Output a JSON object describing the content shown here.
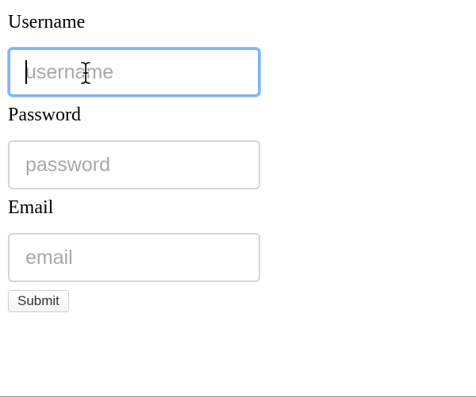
{
  "form": {
    "username": {
      "label": "Username",
      "placeholder": "username",
      "value": ""
    },
    "password": {
      "label": "Password",
      "placeholder": "password",
      "value": ""
    },
    "email": {
      "label": "Email",
      "placeholder": "email",
      "value": ""
    },
    "submit_label": "Submit"
  },
  "colors": {
    "focus_ring": "#80b5f3",
    "input_border": "#d6d6d6",
    "placeholder_text": "#a9a9a9"
  },
  "icons": {
    "mouse_cursor": "ibeam-cursor-icon"
  }
}
